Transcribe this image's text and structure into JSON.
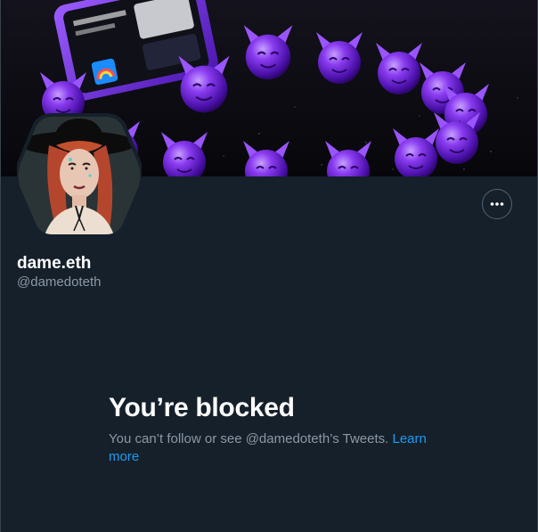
{
  "profile": {
    "display_name": "dame.eth",
    "handle": "@damedoteth"
  },
  "actions": {
    "more_icon": "more-horizontal-icon"
  },
  "blocked": {
    "title": "You’re blocked",
    "message": "You can’t follow or see @damedoteth’s Tweets. ",
    "link_label": "Learn more"
  },
  "colors": {
    "background": "#15202b",
    "primary_text": "#ffffff",
    "secondary_text": "#8b98a5",
    "link": "#1d9bf0",
    "border": "#38444d"
  }
}
